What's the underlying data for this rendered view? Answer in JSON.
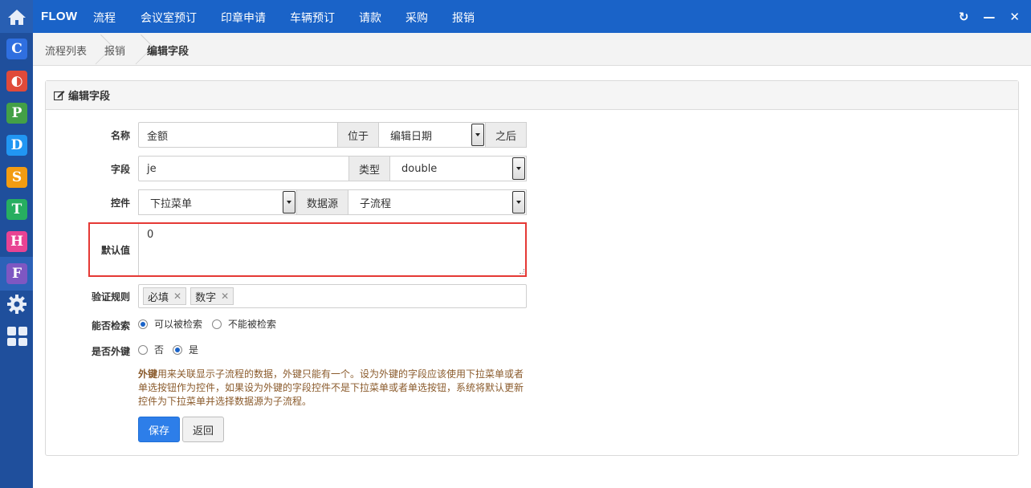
{
  "sidebar": {
    "home_icon": "home-icon",
    "apps": [
      {
        "letter": "C",
        "color": "#2f6fe0"
      },
      {
        "letter": "◐",
        "color": "#e04a3a"
      },
      {
        "letter": "P",
        "color": "#43a047"
      },
      {
        "letter": "D",
        "color": "#2196f3"
      },
      {
        "letter": "S",
        "color": "#f39c12"
      },
      {
        "letter": "T",
        "color": "#27ae60"
      },
      {
        "letter": "H",
        "color": "#e84393"
      },
      {
        "letter": "F",
        "color": "#7e57c2"
      }
    ]
  },
  "topbar": {
    "brand": "FLOW",
    "nav": [
      "流程",
      "会议室预订",
      "印章申请",
      "车辆预订",
      "请款",
      "采购",
      "报销"
    ],
    "actions": {
      "refresh": "↻",
      "minimize": "—",
      "close": "✕"
    }
  },
  "breadcrumb": [
    "流程列表",
    "报销",
    "编辑字段"
  ],
  "panel": {
    "title": "编辑字段"
  },
  "form": {
    "name_label": "名称",
    "name_value": "金额",
    "position_label": "位于",
    "position_value": "编辑日期",
    "after_label": "之后",
    "field_label": "字段",
    "field_value": "je",
    "type_label": "类型",
    "type_value": "double",
    "control_label": "控件",
    "control_value": "下拉菜单",
    "datasource_label": "数据源",
    "datasource_value": "子流程",
    "default_label": "默认值",
    "default_value": "0",
    "validation_label": "验证规则",
    "validation_tags": [
      "必填",
      "数字"
    ],
    "searchable_label": "能否检索",
    "searchable_options": [
      "可以被检索",
      "不能被检索"
    ],
    "searchable_selected": 0,
    "foreign_label": "是否外键",
    "foreign_options": [
      "否",
      "是"
    ],
    "foreign_selected": 1,
    "hint_bold": "外键",
    "hint_line1": "用来关联显示子流程的数据，外键只能有一个。设为外键的字段应该使用下拉菜单或者",
    "hint_line2": "单选按钮作为控件，如果设为外键的字段控件不是下拉菜单或者单选按钮，系统将默认更新",
    "hint_line3": "控件为下拉菜单并选择数据源为子流程。",
    "save": "保存",
    "back": "返回"
  }
}
